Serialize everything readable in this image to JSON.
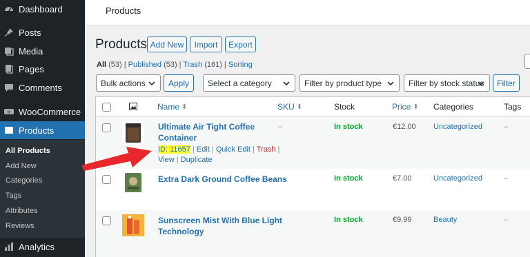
{
  "sidebar": {
    "dashboard": "Dashboard",
    "posts": "Posts",
    "media": "Media",
    "pages": "Pages",
    "comments": "Comments",
    "woocommerce": "WooCommerce",
    "products": "Products",
    "submenu": [
      "All Products",
      "Add New",
      "Categories",
      "Tags",
      "Attributes",
      "Reviews"
    ],
    "analytics": "Analytics"
  },
  "topbar": {
    "title": "Products"
  },
  "page": {
    "title": "Products",
    "buttons": {
      "add_new": "Add New",
      "import": "Import",
      "export": "Export"
    }
  },
  "views": {
    "all": "All",
    "all_count": "(53)",
    "published": "Published",
    "published_count": "(53)",
    "trash": "Trash",
    "trash_count": "(161)",
    "sorting": "Sorting"
  },
  "filters": {
    "bulk_actions": "Bulk actions",
    "apply": "Apply",
    "category": "Select a category",
    "product_type": "Filter by product type",
    "stock_status": "Filter by stock status",
    "filter": "Filter"
  },
  "columns": {
    "name": "Name",
    "sku": "SKU",
    "stock": "Stock",
    "price": "Price",
    "categories": "Categories",
    "tags": "Tags"
  },
  "rows": [
    {
      "name_line1": "Ultimate Air Tight Coffee",
      "name_line2": "Container",
      "actions": {
        "id": "ID: 11657",
        "edit": "Edit",
        "quick_edit": "Quick Edit",
        "trash": "Trash",
        "view": "View",
        "duplicate": "Duplicate"
      },
      "sku": "–",
      "stock": "In stock",
      "price": "€12.00",
      "category": "Uncategorized",
      "tags": "–"
    },
    {
      "name_line1": "Extra Dark Ground Coffee Beans",
      "sku": "–",
      "stock": "In stock",
      "price": "€7.00",
      "category": "Uncategorized",
      "tags": "–"
    },
    {
      "name_line1": "Sunscreen Mist With Blue Light",
      "name_line2": "Technology",
      "sku": "–",
      "stock": "In stock",
      "price": "€9.99",
      "category": "Beauty",
      "tags": "–"
    }
  ],
  "colors": {
    "sidebar_bg": "#1d2327",
    "accent": "#2271b1",
    "in_stock": "#00a32a",
    "highlight": "#ffff33",
    "arrow": "#e8272a"
  },
  "icons": [
    "dashboard-icon",
    "pin-icon",
    "media-icon",
    "pages-icon",
    "comments-icon",
    "woocommerce-icon",
    "products-icon",
    "analytics-icon",
    "image-column-icon",
    "chevron-down-icon",
    "sort-icon"
  ]
}
